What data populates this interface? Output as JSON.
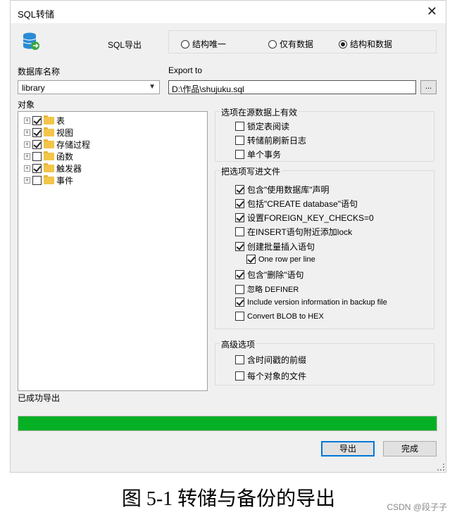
{
  "window": {
    "title": "SQL转储",
    "close_glyph": "✕"
  },
  "export_mode": {
    "label": "SQL导出",
    "options": [
      {
        "label": "结构唯一",
        "selected": false
      },
      {
        "label": "仅有数据",
        "selected": false
      },
      {
        "label": "结构和数据",
        "selected": true
      }
    ]
  },
  "database": {
    "label": "数据库名称",
    "value": "library"
  },
  "export_to": {
    "label": "Export to",
    "value": "D:\\作品\\shujuku.sql",
    "browse_label": "..."
  },
  "objects": {
    "label": "对象",
    "items": [
      {
        "label": "表",
        "checked": true
      },
      {
        "label": "视图",
        "checked": true
      },
      {
        "label": "存储过程",
        "checked": true
      },
      {
        "label": "函数",
        "checked": false
      },
      {
        "label": "触发器",
        "checked": true
      },
      {
        "label": "事件",
        "checked": false
      }
    ]
  },
  "source_options": {
    "title": "选项在源数据上有效",
    "items": [
      {
        "label": "锁定表阅读",
        "checked": false
      },
      {
        "label": "转储前刷新日志",
        "checked": false
      },
      {
        "label": "单个事务",
        "checked": false
      }
    ]
  },
  "file_options": {
    "title": "把选项写进文件",
    "items": [
      {
        "label": "包含\"使用数据库\"声明",
        "checked": true
      },
      {
        "label": "包括\"CREATE database\"语句",
        "checked": true
      },
      {
        "label": "设置FOREIGN_KEY_CHECKS=0",
        "checked": true
      },
      {
        "label": "在INSERT语句附近添加lock",
        "checked": false
      },
      {
        "label": "创建批量插入语句",
        "checked": true
      },
      {
        "label": "One row per line",
        "checked": true
      },
      {
        "label": "包含\"删除\"语句",
        "checked": true
      },
      {
        "label": "忽略 DEFINER",
        "checked": false
      },
      {
        "label": "Include version information in backup file",
        "checked": true
      },
      {
        "label": "Convert BLOB to HEX",
        "checked": false
      }
    ]
  },
  "advanced": {
    "title": "高级选项",
    "items": [
      {
        "label": "含时间戳的前缀",
        "checked": false
      },
      {
        "label": "每个对象的文件",
        "checked": false
      }
    ]
  },
  "status": {
    "text": "已成功导出"
  },
  "progress": {
    "value_pct": 100,
    "color": "#06b025"
  },
  "buttons": {
    "export": "导出",
    "finish": "完成"
  },
  "caption": "图 5-1 转储与备份的导出",
  "watermark": "CSDN @段子子",
  "colors": {
    "accent": "#0078d7",
    "db_icon": "#2a8bd6",
    "db_badge": "#3aa641"
  }
}
